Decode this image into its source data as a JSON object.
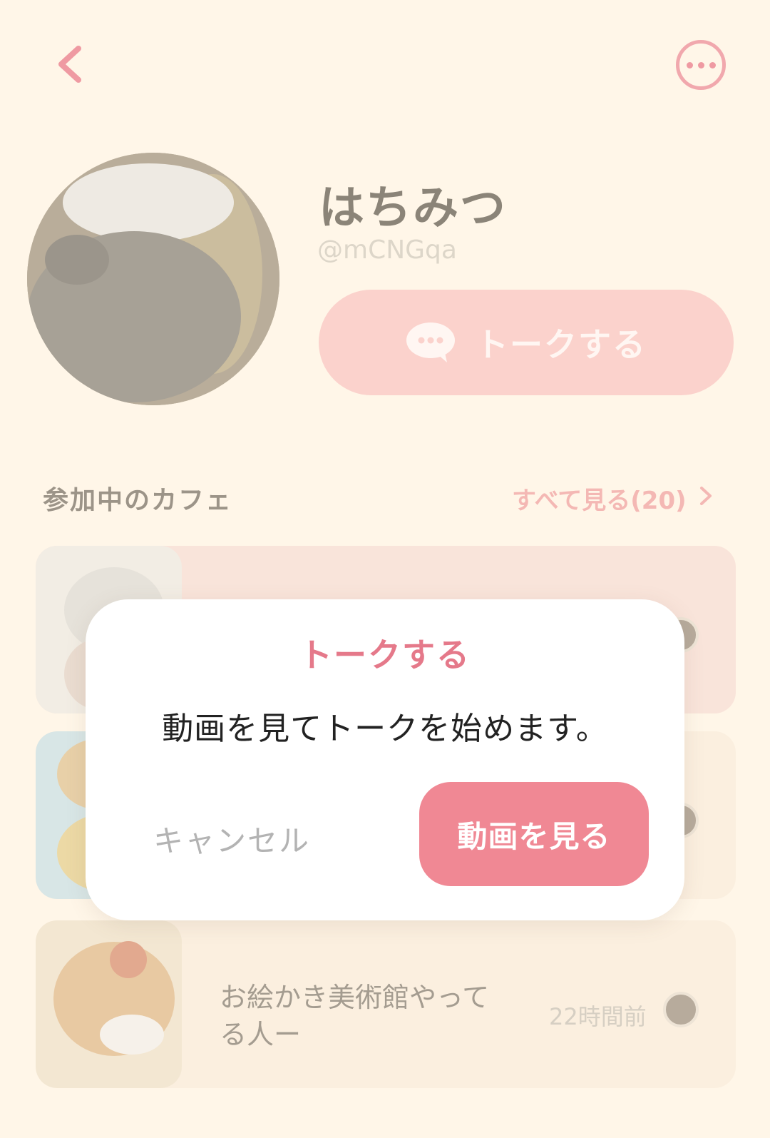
{
  "profile": {
    "name": "はちみつ",
    "handle": "@mCNGqa",
    "talk_button_label": "トークする"
  },
  "cafes_section": {
    "title": "参加中のカフェ",
    "see_all_label": "すべて見る(20)",
    "cards": [
      {
        "title": "",
        "time": ""
      },
      {
        "title": "",
        "time": ""
      },
      {
        "title": "お絵かき美術館やってる人ー",
        "time": "22時間前"
      }
    ]
  },
  "dialog": {
    "title": "トークする",
    "message": "動画を見てトークを始めます。",
    "cancel_label": "キャンセル",
    "confirm_label": "動画を見る"
  },
  "colors": {
    "background": "#fff6e8",
    "accent_pink": "#f08894",
    "title_pink": "#e5798a",
    "talk_button": "#fbd2cc"
  },
  "icons": [
    "chevron-left-icon",
    "more-icon",
    "chat-bubble-icon",
    "chevron-right-icon"
  ]
}
